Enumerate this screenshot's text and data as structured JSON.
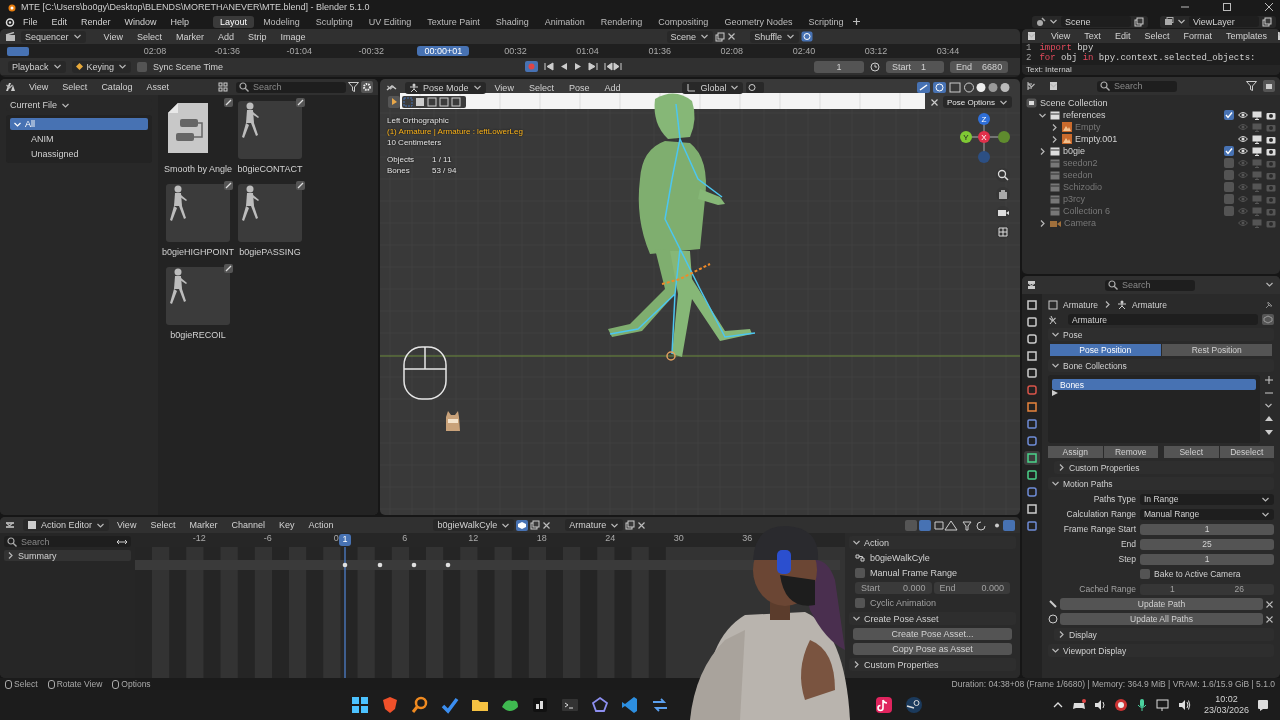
{
  "window": {
    "title": "MTE [C:\\Users\\bo0gy\\Desktop\\BLENDS\\MORETHANEVER\\MTE.blend] - Blender 5.1.0"
  },
  "menus": [
    "File",
    "Edit",
    "Render",
    "Window",
    "Help"
  ],
  "workspaces": [
    {
      "label": "Layout",
      "selected": true
    },
    {
      "label": "Modeling",
      "selected": false
    },
    {
      "label": "Sculpting",
      "selected": false
    },
    {
      "label": "UV Editing",
      "selected": false
    },
    {
      "label": "Texture Paint",
      "selected": false
    },
    {
      "label": "Shading",
      "selected": false
    },
    {
      "label": "Animation",
      "selected": false
    },
    {
      "label": "Rendering",
      "selected": false
    },
    {
      "label": "Compositing",
      "selected": false
    },
    {
      "label": "Geometry Nodes",
      "selected": false
    },
    {
      "label": "Scripting",
      "selected": false
    }
  ],
  "scene": {
    "scene": "Scene",
    "view_layer": "ViewLayer"
  },
  "sequencer": {
    "editor": "Sequencer",
    "menus": [
      "View",
      "Select",
      "Marker",
      "Add",
      "Strip",
      "Image"
    ],
    "scene": "Scene",
    "mode": "Shuffle",
    "ruler": [
      {
        "label": "02:08",
        "selected": false
      },
      {
        "label": "-01:36",
        "selected": false
      },
      {
        "label": "-01:04",
        "selected": false
      },
      {
        "label": "-00:32",
        "selected": false
      },
      {
        "label": "00:00+01",
        "selected": true
      },
      {
        "label": "00:32",
        "selected": false
      },
      {
        "label": "01:04",
        "selected": false
      },
      {
        "label": "01:36",
        "selected": false
      },
      {
        "label": "02:08",
        "selected": false
      },
      {
        "label": "02:40",
        "selected": false
      },
      {
        "label": "03:12",
        "selected": false
      },
      {
        "label": "03:44",
        "selected": false
      }
    ]
  },
  "timeline": {
    "playback": "Playback",
    "keying": "Keying",
    "sync": {
      "label": "Sync Scene Time",
      "checked": false
    },
    "frame": "1",
    "start": {
      "label": "Start",
      "value": "1"
    },
    "end": {
      "label": "End",
      "value": "6680"
    }
  },
  "asset_browser": {
    "menus": [
      "View",
      "Select",
      "Catalog",
      "Asset"
    ],
    "search": {
      "placeholder": "Search"
    },
    "library": "Current File",
    "catalogs": [
      {
        "label": "All",
        "selected": true,
        "expanded": true,
        "children": [
          {
            "label": "ANIM",
            "selected": false
          },
          {
            "label": "Unassigned",
            "selected": false
          }
        ]
      }
    ],
    "assets": [
      {
        "name": "Smooth by Angle",
        "kind": "node_group"
      },
      {
        "name": "b0gieCONTACT",
        "kind": "pose"
      },
      {
        "name": "b0gieHIGHPOINT",
        "kind": "pose"
      },
      {
        "name": "b0giePASSING",
        "kind": "pose"
      },
      {
        "name": "b0gieRECOIL",
        "kind": "pose"
      }
    ]
  },
  "viewport": {
    "mode": "Pose Mode",
    "menus": [
      "View",
      "Select",
      "Pose",
      "Add"
    ],
    "orientation": "Global",
    "options": "Pose Options",
    "info": [
      {
        "text": "Left Orthographic",
        "kind": "plain"
      },
      {
        "text": "(1) Armature | Armature : leftLowerLeg",
        "kind": "active"
      },
      {
        "text": "10 Centimeters",
        "kind": "plain"
      }
    ],
    "stats": [
      {
        "label": "Objects",
        "value": "1 / 11"
      },
      {
        "label": "Bones",
        "value": "53 / 94"
      }
    ],
    "gizmo": {
      "z": "Z",
      "y": "Y",
      "x": "X"
    }
  },
  "action_editor": {
    "editor": "Action Editor",
    "menus": [
      "View",
      "Select",
      "Marker",
      "Channel",
      "Key",
      "Action"
    ],
    "action": "b0gieWalkCyle",
    "object": "Armature",
    "search": {
      "placeholder": "Search"
    },
    "channels": [
      "Summary"
    ],
    "ruler": [
      "-12",
      "-6",
      "0",
      "6",
      "12",
      "18",
      "24",
      "30",
      "36"
    ],
    "current_frame": "1",
    "panel": {
      "action": {
        "title": "Action",
        "expanded": true,
        "name": "b0gieWalkCyle",
        "manual_range": {
          "label": "Manual Frame Range",
          "checked": false
        },
        "start": {
          "label": "Start",
          "value": "0.000"
        },
        "end": {
          "label": "End",
          "value": "0.000"
        },
        "cyclic": {
          "label": "Cyclic Animation",
          "checked": false
        }
      },
      "pose_asset": {
        "title": "Create Pose Asset",
        "expanded": true,
        "buttons": [
          "Create Pose Asset...",
          "Copy Pose as Asset"
        ]
      },
      "custom_properties": {
        "title": "Custom Properties",
        "expanded": false
      }
    }
  },
  "text_editor": {
    "menus": [
      "View",
      "Text",
      "Edit",
      "Select",
      "Format",
      "Templates"
    ],
    "lines": [
      {
        "number": "1",
        "tokens": [
          {
            "text": "import",
            "kind": "keyword"
          },
          {
            "text": " bpy",
            "kind": "plain"
          }
        ]
      },
      {
        "number": "2",
        "tokens": [
          {
            "text": "for",
            "kind": "keyword"
          },
          {
            "text": " obj ",
            "kind": "plain"
          },
          {
            "text": "in",
            "kind": "keyword"
          },
          {
            "text": " bpy.context.selected_objects:",
            "kind": "plain"
          }
        ]
      }
    ],
    "footer": "Text: Internal"
  },
  "outliner": {
    "search": {
      "placeholder": "Search"
    },
    "root": "Scene Collection",
    "items": [
      {
        "name": "references",
        "kind": "collection",
        "expanded": true,
        "checked": true,
        "disabled": false,
        "children": [
          {
            "name": "Empty",
            "kind": "empty",
            "expanded": false,
            "disabled": true
          },
          {
            "name": "Empty.001",
            "kind": "empty",
            "expanded": false,
            "disabled": false
          }
        ]
      },
      {
        "name": "b0gie",
        "kind": "collection",
        "expanded": false,
        "checked": true,
        "disabled": false
      },
      {
        "name": "seedon2",
        "kind": "collection",
        "checked": false,
        "disabled": true
      },
      {
        "name": "seedon",
        "kind": "collection",
        "checked": false,
        "disabled": true
      },
      {
        "name": "Schizodio",
        "kind": "collection",
        "checked": false,
        "disabled": true
      },
      {
        "name": "p3rcy",
        "kind": "collection",
        "checked": false,
        "disabled": true
      },
      {
        "name": "Collection 6",
        "kind": "collection",
        "checked": false,
        "disabled": true
      },
      {
        "name": "Camera",
        "kind": "camera",
        "expanded": false,
        "disabled": true
      }
    ]
  },
  "properties": {
    "search": {
      "placeholder": "Search"
    },
    "tabs": [
      {
        "selected": false
      },
      {
        "selected": false
      },
      {
        "selected": false
      },
      {
        "selected": false
      },
      {
        "selected": false
      },
      {
        "selected": false
      },
      {
        "selected": false
      },
      {
        "selected": false
      },
      {
        "selected": false
      },
      {
        "selected": true
      },
      {
        "selected": false
      },
      {
        "selected": false
      },
      {
        "selected": false
      },
      {
        "selected": false
      }
    ],
    "breadcrumb": [
      "Armature",
      "Armature"
    ],
    "data_name": "Armature",
    "pose": {
      "title": "Pose",
      "expanded": true,
      "options": [
        {
          "label": "Pose Position",
          "selected": true
        },
        {
          "label": "Rest Position",
          "selected": false
        }
      ]
    },
    "bone_collections": {
      "title": "Bone Collections",
      "expanded": true,
      "items": [
        {
          "label": "Bones",
          "selected": true
        }
      ],
      "buttons": [
        "Assign",
        "Remove",
        "Select",
        "Deselect"
      ],
      "custom_properties": {
        "title": "Custom Properties",
        "expanded": false
      }
    },
    "motion_paths": {
      "title": "Motion Paths",
      "expanded": true,
      "fields": [
        {
          "label": "Paths Type",
          "value": "In Range",
          "kind": "dropdown"
        },
        {
          "label": "Calculation Range",
          "value": "Manual Range",
          "kind": "dropdown"
        },
        {
          "label": "Frame Range Start",
          "value": "1",
          "kind": "number"
        },
        {
          "label": "End",
          "value": "25",
          "kind": "number"
        },
        {
          "label": "Step",
          "value": "1",
          "kind": "number"
        }
      ],
      "bake": {
        "label": "Bake to Active Camera",
        "checked": false
      },
      "cached": {
        "label": "Cached Range",
        "from": "1",
        "to": "26"
      },
      "actions": [
        "Update Path",
        "Update All Paths"
      ],
      "display": {
        "title": "Display",
        "expanded": false
      }
    },
    "viewport_display": {
      "title": "Viewport Display",
      "expanded": true
    }
  },
  "status_bar": {
    "hints": [
      "Select",
      "Rotate View",
      "Options"
    ],
    "info": "Duration: 04:38+08 (Frame 1/6680) | Memory: 364.9 MiB | VRAM: 1.6/15.9 GiB | 5.1.0"
  },
  "taskbar": {
    "time": "10:02",
    "date": "23/03/2026"
  }
}
